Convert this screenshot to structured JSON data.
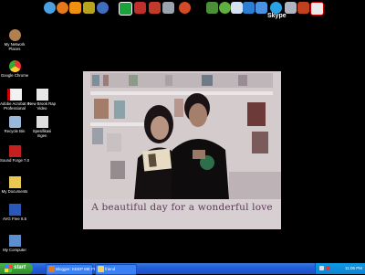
{
  "toolbar": {
    "skype_label": "Skype"
  },
  "desktop_icons": [
    {
      "label": "My Network Places"
    },
    {
      "label": "Google Chrome"
    },
    {
      "label": "Adobe Acrobat 8 Professional"
    },
    {
      "label": "Recycle Bin"
    },
    {
      "label": "Sound Forge 7.0"
    },
    {
      "label": "My Documents"
    },
    {
      "label": "AVG Free 8.5"
    },
    {
      "label": "My Computer"
    },
    {
      "label": "New Brook Rap Video"
    },
    {
      "label": "Spesifikasi Ingen"
    }
  ],
  "wallpaper": {
    "caption": "A beautiful day for a wonderful love"
  },
  "taskbar": {
    "start_label": "start",
    "tasks": [
      {
        "label": "Blogger: KEEP ME FR..."
      },
      {
        "label": "friend"
      }
    ],
    "clock": "11:06 PM"
  }
}
